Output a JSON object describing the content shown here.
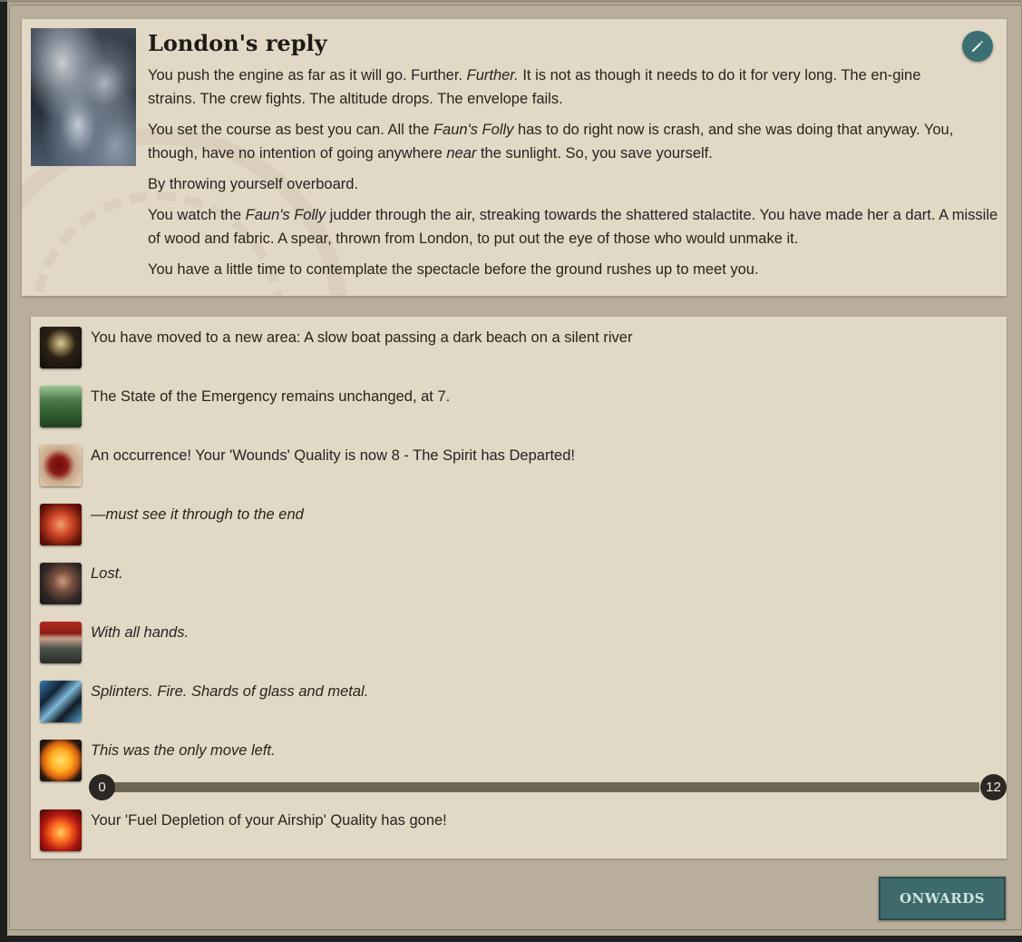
{
  "story": {
    "title": "London's reply",
    "image_icon": "storm-clouds-image",
    "paragraphs": [
      {
        "parts": [
          {
            "t": "You push the engine as far as it will go. Further. "
          },
          {
            "t": "Further.",
            "em": true
          },
          {
            "t": " It is not as though it needs to do it for very long. The en-gine strains. The crew fights. The altitude drops. The envelope fails."
          }
        ]
      },
      {
        "parts": [
          {
            "t": "You set the course as best you can. All the "
          },
          {
            "t": "Faun's Folly",
            "em": true
          },
          {
            "t": " has to do right now is crash, and she was doing that anyway. You, though, have no intention of going anywhere "
          },
          {
            "t": "near",
            "em": true
          },
          {
            "t": " the sunlight. So, you save yourself."
          }
        ]
      },
      {
        "parts": [
          {
            "t": "By throwing yourself overboard."
          }
        ]
      },
      {
        "parts": [
          {
            "t": "You watch the "
          },
          {
            "t": "Faun's Folly",
            "em": true
          },
          {
            "t": " judder through the air, streaking towards the shattered stalactite. You have made her a dart. A missile of wood and fabric. A spear, thrown from London, to put out the eye of those who would unmake it."
          }
        ]
      },
      {
        "parts": [
          {
            "t": "You have a little time to contemplate the spectacle before the ground rushes up to meet you."
          }
        ]
      }
    ]
  },
  "results": [
    {
      "icon": "skeleton-icon",
      "text": "You have moved to a new area: A slow boat passing a dark beach on a silent river",
      "italic": false
    },
    {
      "icon": "forest-icon",
      "text": "The State of the Emergency remains unchanged, at 7.",
      "italic": false
    },
    {
      "icon": "blood-splatter-icon",
      "text": "An occurrence! Your 'Wounds' Quality is now 8 - The Spirit has Departed!",
      "italic": false
    },
    {
      "icon": "clenched-fist-icon",
      "text": "—must see it through to the end",
      "italic": true
    },
    {
      "icon": "scarred-man-icon",
      "text": "Lost.",
      "italic": true
    },
    {
      "icon": "sailor-icon",
      "text": "With all hands.",
      "italic": true
    },
    {
      "icon": "shattered-glass-icon",
      "text": "Splinters. Fire. Shards of glass and metal.",
      "italic": true
    },
    {
      "icon": "sun-icon",
      "text": "This was the only move left.",
      "italic": true,
      "progress": {
        "min": "0",
        "max": "12",
        "fraction": 1.0
      }
    },
    {
      "icon": "furnace-icon",
      "text": "Your 'Fuel Depletion of your Airship' Quality has gone!",
      "italic": false
    }
  ],
  "buttons": {
    "onwards": "ONWARDS",
    "edit_icon": "pencil-icon"
  }
}
